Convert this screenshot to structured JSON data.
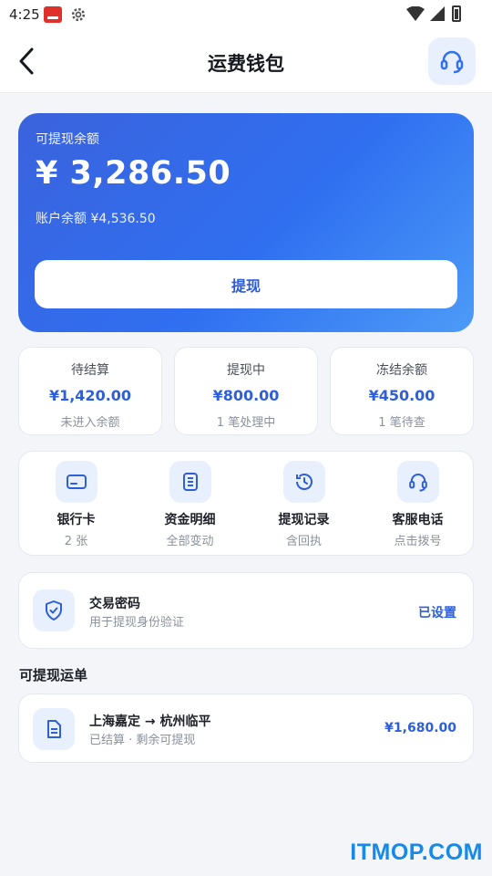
{
  "status_bar": {
    "time": "4:25"
  },
  "header": {
    "title": "运费钱包",
    "back_icon": "chevron-left-icon",
    "support_icon": "headset-icon"
  },
  "balance": {
    "label": "可提现余额",
    "amount": "¥ 3,286.50",
    "account_balance": "账户余额 ¥4,536.50",
    "withdraw_label": "提现",
    "gradient": [
      "#3b63dd",
      "#4c9bf8"
    ]
  },
  "stats": [
    {
      "label": "待结算",
      "value": "¥1,420.00",
      "note": "未进入余额"
    },
    {
      "label": "提现中",
      "value": "¥800.00",
      "note": "1 笔处理中"
    },
    {
      "label": "冻结余额",
      "value": "¥450.00",
      "note": "1 笔待查"
    }
  ],
  "shortcuts": [
    {
      "label": "银行卡",
      "sub": "2 张",
      "icon": "credit-card-icon"
    },
    {
      "label": "资金明细",
      "sub": "全部变动",
      "icon": "document-list-icon"
    },
    {
      "label": "提现记录",
      "sub": "含回执",
      "icon": "history-icon"
    },
    {
      "label": "客服电话",
      "sub": "点击拨号",
      "icon": "headset-icon"
    }
  ],
  "password": {
    "title": "交易密码",
    "sub": "用于提现身份验证",
    "status": "已设置",
    "icon": "shield-check-icon"
  },
  "orders_section": {
    "title": "可提现运单"
  },
  "orders": [
    {
      "route": "上海嘉定 → 杭州临平",
      "status": "已结算 · 剩余可提现",
      "amount": "¥1,680.00",
      "icon": "document-icon"
    }
  ],
  "watermark": "ITMOP.COM",
  "colors": {
    "accent": "#2f5fd6",
    "background": "#f3f5f9"
  }
}
